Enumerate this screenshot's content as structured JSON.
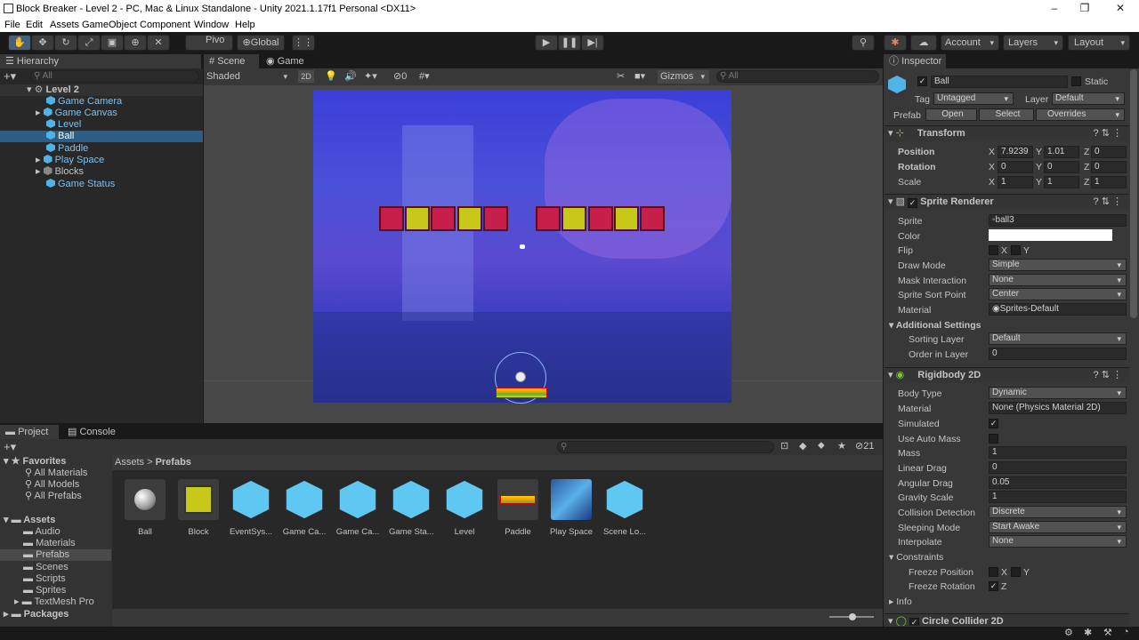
{
  "window": {
    "title": "Block Breaker - Level 2 - PC, Mac & Linux Standalone - Unity 2021.1.17f1 Personal <DX11>"
  },
  "menu": [
    "File",
    "Edit",
    "Assets",
    "GameObject",
    "Component",
    "Window",
    "Help"
  ],
  "toolbar": {
    "pivot": "Pivo",
    "global": "Global",
    "account": "Account",
    "layers": "Layers",
    "layout": "Layout"
  },
  "hierarchy": {
    "tab": "Hierarchy",
    "search_placeholder": "All",
    "scene": "Level 2",
    "items": [
      "Game Camera",
      "Game Canvas",
      "Level",
      "Ball",
      "Paddle",
      "Play Space",
      "Blocks",
      "Game Status"
    ]
  },
  "scene_tabs": {
    "scene": "Scene",
    "game": "Game",
    "shaded": "Shaded",
    "dim": "2D",
    "gizmos": "Gizmos",
    "search_placeholder": "All",
    "hidden_count": "0"
  },
  "inspector": {
    "tab": "Inspector",
    "name": "Ball",
    "static": "Static",
    "tag_label": "Tag",
    "tag": "Untagged",
    "layer_label": "Layer",
    "layer": "Default",
    "prefab_label": "Prefab",
    "open": "Open",
    "select": "Select",
    "overrides": "Overrides",
    "transform": {
      "title": "Transform",
      "position_label": "Position",
      "rotation_label": "Rotation",
      "scale_label": "Scale",
      "pos": [
        "7.9239",
        "1.01",
        "0"
      ],
      "rot": [
        "0",
        "0",
        "0"
      ],
      "scale": [
        "1",
        "1",
        "1"
      ]
    },
    "sprite_renderer": {
      "title": "Sprite Renderer",
      "sprite_label": "Sprite",
      "sprite": "ball3",
      "color_label": "Color",
      "flip_label": "Flip",
      "draw_mode_label": "Draw Mode",
      "draw_mode": "Simple",
      "mask_label": "Mask Interaction",
      "mask": "None",
      "sort_point_label": "Sprite Sort Point",
      "sort_point": "Center",
      "material_label": "Material",
      "material": "Sprites-Default",
      "additional": "Additional Settings",
      "sorting_layer_label": "Sorting Layer",
      "sorting_layer": "Default",
      "order_label": "Order in Layer",
      "order": "0"
    },
    "rigidbody": {
      "title": "Rigidbody 2D",
      "body_type_label": "Body Type",
      "body_type": "Dynamic",
      "material_label": "Material",
      "material": "None (Physics Material 2D)",
      "simulated_label": "Simulated",
      "auto_mass_label": "Use Auto Mass",
      "mass_label": "Mass",
      "mass": "1",
      "linear_drag_label": "Linear Drag",
      "linear_drag": "0",
      "angular_drag_label": "Angular Drag",
      "angular_drag": "0.05",
      "gravity_label": "Gravity Scale",
      "gravity": "1",
      "collision_label": "Collision Detection",
      "collision": "Discrete",
      "sleeping_label": "Sleeping Mode",
      "sleeping": "Start Awake",
      "interpolate_label": "Interpolate",
      "interpolate": "None",
      "constraints_label": "Constraints",
      "freeze_pos_label": "Freeze Position",
      "freeze_rot_label": "Freeze Rotation",
      "info_label": "Info"
    },
    "circle_collider": "Circle Collider 2D"
  },
  "project": {
    "tab": "Project",
    "console": "Console",
    "favorites": "Favorites",
    "fav_items": [
      "All Materials",
      "All Models",
      "All Prefabs"
    ],
    "assets": "Assets",
    "folders": [
      "Audio",
      "Materials",
      "Prefabs",
      "Scenes",
      "Scripts",
      "Sprites",
      "TextMesh Pro"
    ],
    "packages": "Packages",
    "breadcrumb_root": "Assets",
    "breadcrumb_current": "Prefabs",
    "count": "21",
    "asset_items": [
      "Ball",
      "Block",
      "EventSys...",
      "Game Ca...",
      "Game Ca...",
      "Game Sta...",
      "Level",
      "Paddle",
      "Play Space",
      "Scene Lo..."
    ]
  },
  "colors": {
    "accent": "#2c5d87",
    "brick_red": "#c81e4a",
    "brick_yellow": "#c8c819",
    "cube": "#4fb3e8"
  }
}
